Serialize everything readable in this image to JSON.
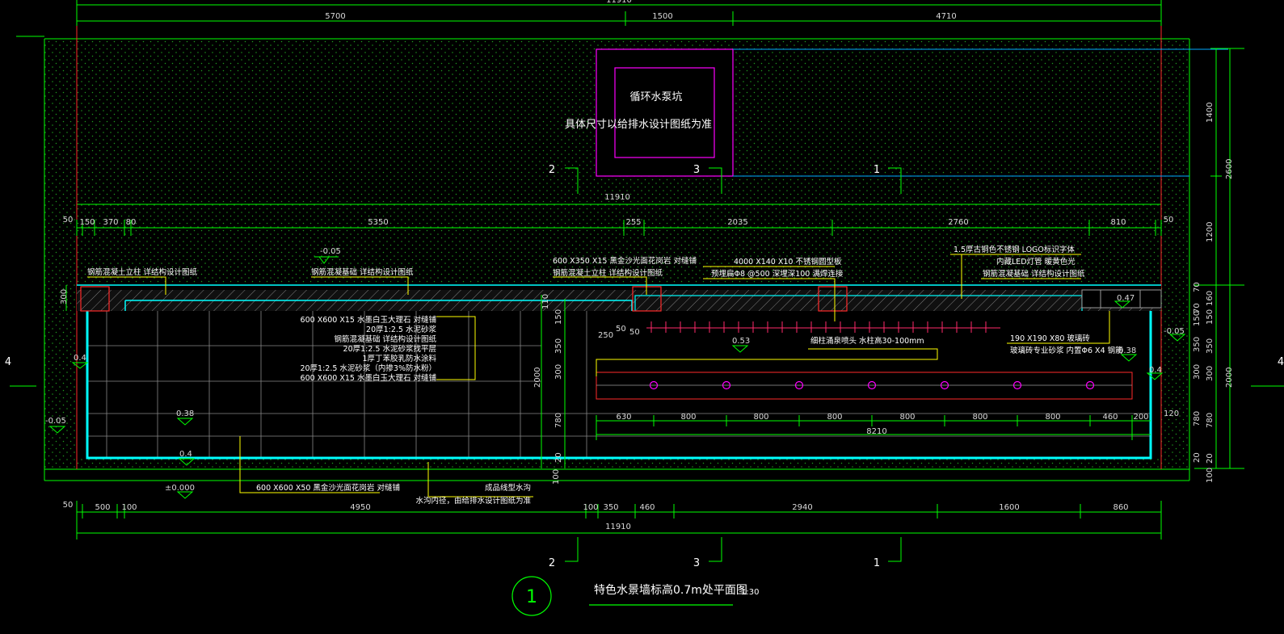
{
  "title": "特色水景墙标高0.7m处平面图",
  "scale": "1:30",
  "drawing_number": "1",
  "pump_pit": {
    "line1": "循环水泵坑",
    "line2": "具体尺寸以给排水设计图纸为准"
  },
  "section_marks": {
    "a": "2",
    "b": "3",
    "c": "1"
  },
  "side_marks": {
    "left": "4",
    "right": "4"
  },
  "top_dims": {
    "total": "11910",
    "a": "5700",
    "b": "1500",
    "c": "4710",
    "mid_total": "11910"
  },
  "second_dims": [
    "50",
    "150",
    "370",
    "80",
    "5350",
    "255",
    "2035",
    "2760",
    "810",
    "50"
  ],
  "right_dims": [
    "1400",
    "2600",
    "1200",
    "70",
    "160",
    "150",
    "350",
    "300",
    "2000",
    "780",
    "20",
    "100"
  ],
  "right_dims2": [
    "70",
    "150",
    "350",
    "300",
    "780",
    "20"
  ],
  "left_dims": [
    "300",
    "110",
    "150",
    "350",
    "2000",
    "300",
    "780",
    "20",
    "100"
  ],
  "bottom_dims": [
    "50",
    "500",
    "100",
    "4950",
    "100",
    "350",
    "460",
    "2940",
    "1600",
    "860"
  ],
  "bottom_total": "11910",
  "jet_dims": [
    "630",
    "800",
    "800",
    "800",
    "800",
    "800",
    "800",
    "460",
    "200"
  ],
  "jet_total": "8210",
  "mini_dims": {
    "d250": "250",
    "d50a": "50",
    "d50b": "50",
    "d120": "120"
  },
  "levels": {
    "m005a": "-0.05",
    "m005b": "-0.05",
    "m005c": "-0.05",
    "p04a": "0.4",
    "p04b": "0.4",
    "p04c": "0.4",
    "p038a": "0.38",
    "p038b": "0.38",
    "p053": "0.53",
    "p047": "0.47",
    "zero": "±0.000"
  },
  "notes": {
    "n1": "钢筋混凝土立柱  详结构设计图纸",
    "n2": "钢筋混凝基础  详结构设计图纸",
    "n3": "600 X350 X15  黑金沙光面花岗岩  对缝铺",
    "n4": "钢筋混凝土立柱  详结构设计图纸",
    "n5": "4000 X140 X10  不锈钢圆型板",
    "n6": "预埋扁Φ8 @500  深埋深100  满焊连接",
    "n7": "1.5厚古铜色不锈钢  LOGO标识字体",
    "n8": "内藏LED灯管  暖黄色光",
    "n9": "钢筋混凝基础  详结构设计图纸",
    "stack": [
      "600 X600 X15  水墨白玉大理石  对缝铺",
      "20厚1:2.5 水泥砂浆",
      "钢筋混凝基础  详结构设计图纸",
      "20厚1:2.5 水泥砂浆找平层",
      "1厚丁苯胶乳防水涂料",
      "20厚1:2.5 水泥砂浆（内掺3%防水粉）",
      "600 X600 X15  水墨白玉大理石  对缝铺"
    ],
    "n10": "细柱涌泉喷头  水柱高30-100mm",
    "n11": "190 X190 X80  玻璃砖",
    "n12": "玻璃砖专业砂浆  内置Φ6 X4 钢筋",
    "n13": "600 X600 X50  黑金沙光面花岗岩  对缝铺",
    "n14": "成品线型水沟",
    "n15": "水沟内径，由给排水设计图纸为准"
  },
  "colors": {
    "background": "#000000",
    "green": "#00ff00",
    "cyan": "#00ffff",
    "magenta": "#ff00ff",
    "red": "#ff0000",
    "yellow": "#ffff00",
    "white": "#ffffff",
    "gray": "#9a9a9a"
  }
}
